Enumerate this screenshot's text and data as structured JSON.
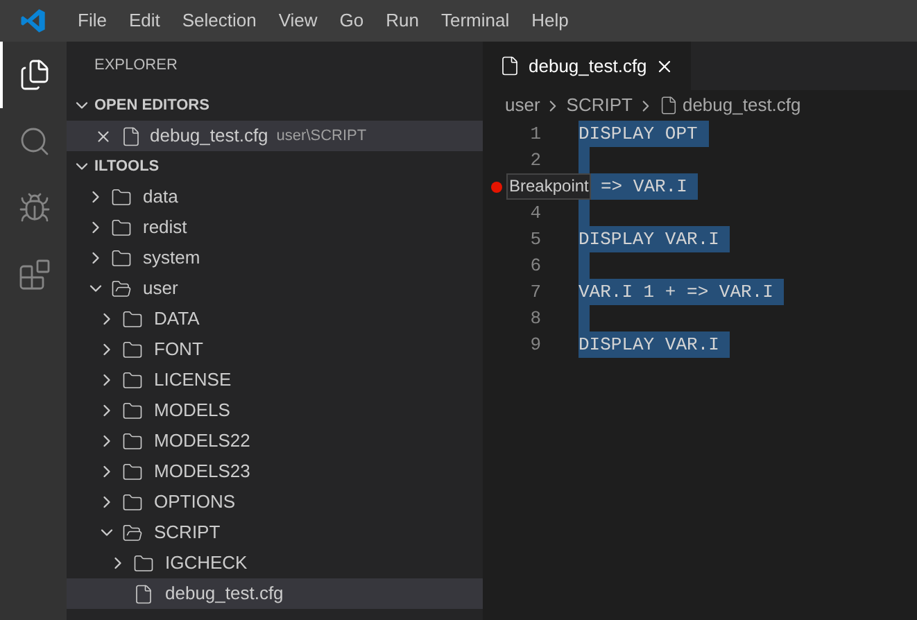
{
  "menu": [
    "File",
    "Edit",
    "Selection",
    "View",
    "Go",
    "Run",
    "Terminal",
    "Help"
  ],
  "activity_bar": [
    {
      "kind": "files",
      "selected": true
    },
    {
      "kind": "search",
      "selected": false
    },
    {
      "kind": "debug",
      "selected": false
    },
    {
      "kind": "extensions",
      "selected": false
    }
  ],
  "sidebar": {
    "title": "EXPLORER",
    "open_editors": {
      "label": "OPEN EDITORS",
      "expanded": true,
      "items": [
        {
          "name": "debug_test.cfg",
          "path": "user\\SCRIPT",
          "selected": true
        }
      ]
    },
    "tree": {
      "label": "ILTOOLS",
      "expanded": true,
      "children": [
        {
          "name": "data",
          "kind": "folder",
          "expanded": false,
          "selected": false
        },
        {
          "name": "redist",
          "kind": "folder",
          "expanded": false,
          "selected": false
        },
        {
          "name": "system",
          "kind": "folder",
          "expanded": false,
          "selected": false
        },
        {
          "name": "user",
          "kind": "folder",
          "expanded": true,
          "selected": false,
          "children": [
            {
              "name": "DATA",
              "kind": "folder",
              "expanded": false,
              "selected": false
            },
            {
              "name": "FONT",
              "kind": "folder",
              "expanded": false,
              "selected": false
            },
            {
              "name": "LICENSE",
              "kind": "folder",
              "expanded": false,
              "selected": false
            },
            {
              "name": "MODELS",
              "kind": "folder",
              "expanded": false,
              "selected": false
            },
            {
              "name": "MODELS22",
              "kind": "folder",
              "expanded": false,
              "selected": false
            },
            {
              "name": "MODELS23",
              "kind": "folder",
              "expanded": false,
              "selected": false
            },
            {
              "name": "OPTIONS",
              "kind": "folder",
              "expanded": false,
              "selected": false
            },
            {
              "name": "SCRIPT",
              "kind": "folder",
              "expanded": true,
              "selected": false,
              "children": [
                {
                  "name": "IGCHECK",
                  "kind": "folder",
                  "expanded": false,
                  "selected": false
                },
                {
                  "name": "debug_test.cfg",
                  "kind": "file",
                  "selected": true
                }
              ]
            }
          ]
        }
      ]
    }
  },
  "editor": {
    "tabs": [
      {
        "label": "debug_test.cfg",
        "selected": true
      }
    ],
    "breadcrumb": [
      "user",
      "SCRIPT",
      "debug_test.cfg"
    ],
    "lines": [
      {
        "number": "1",
        "text": "DISPLAY OPT",
        "breakpoint": false
      },
      {
        "number": "2",
        "breakpoint": false
      },
      {
        "text": "=> VAR.I",
        "breakpoint": true,
        "tooltip": "Breakpoint"
      },
      {
        "number": "4",
        "breakpoint": false
      },
      {
        "number": "5",
        "text": "DISPLAY VAR.I",
        "breakpoint": false
      },
      {
        "number": "6",
        "breakpoint": false
      },
      {
        "number": "7",
        "text": "VAR.I 1 + => VAR.I",
        "breakpoint": false
      },
      {
        "number": "8",
        "breakpoint": false
      },
      {
        "number": "9",
        "text": "DISPLAY VAR.I",
        "breakpoint": false
      }
    ]
  }
}
